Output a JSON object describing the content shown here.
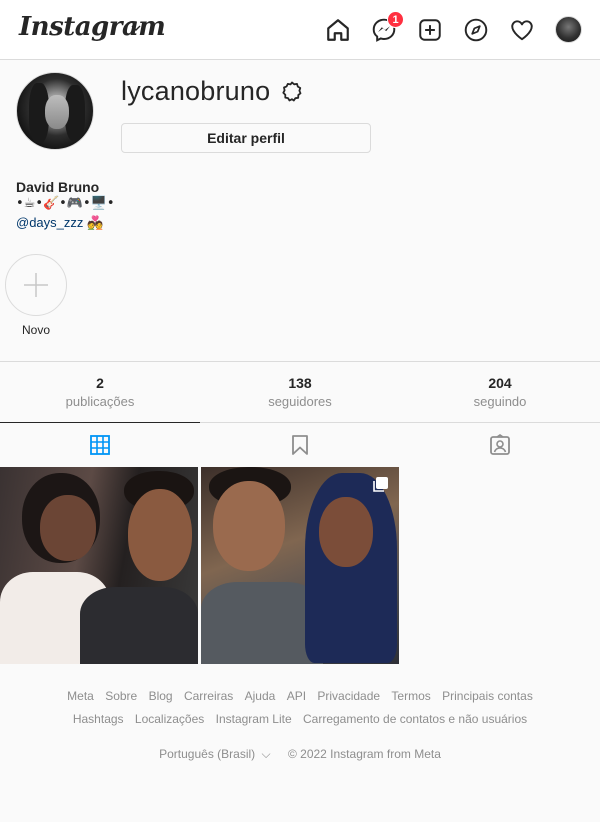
{
  "nav": {
    "logo": "Instagram",
    "messages_badge": "1"
  },
  "profile": {
    "username": "lycanobruno",
    "edit_button": "Editar perfil",
    "name": "David Bruno",
    "bio_line": "•☕•🎸•🎮•🖥️•",
    "bio_link": "@days_zzz 💑"
  },
  "highlight": {
    "new_label": "Novo"
  },
  "stats": [
    {
      "value": "2",
      "label": "publicações"
    },
    {
      "value": "138",
      "label": "seguidores"
    },
    {
      "value": "204",
      "label": "seguindo"
    }
  ],
  "footer": {
    "row1": [
      "Meta",
      "Sobre",
      "Blog",
      "Carreiras",
      "Ajuda",
      "API",
      "Privacidade",
      "Termos",
      "Principais contas"
    ],
    "row2": [
      "Hashtags",
      "Localizações",
      "Instagram Lite",
      "Carregamento de contatos e não usuários"
    ],
    "language": "Português (Brasil)",
    "copyright": "© 2022 Instagram from Meta"
  },
  "colors": {
    "accent_blue": "#0095f6",
    "badge_red": "#ff3040",
    "text_primary": "#262626",
    "text_secondary": "#8e8e8e",
    "border": "#dbdbdb"
  }
}
